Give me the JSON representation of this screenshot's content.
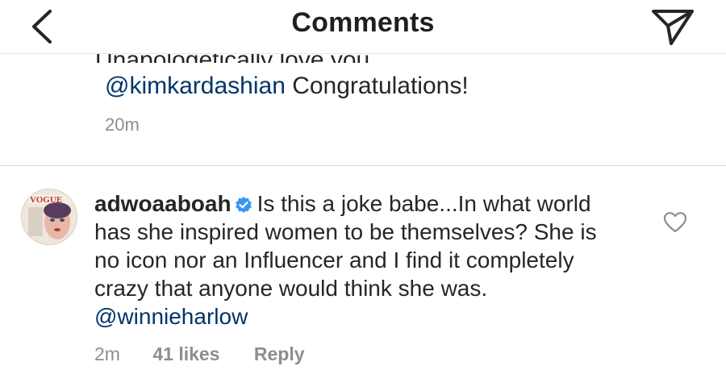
{
  "header": {
    "title": "Comments",
    "back_icon": "chevron-left-icon",
    "share_icon": "paper-plane-icon"
  },
  "previous_comment": {
    "partial_line": "Unapologetically  love you",
    "mention": "@kimkardashian",
    "text": " Congratulations!",
    "time": "20m"
  },
  "comment": {
    "username": "adwoaaboah",
    "verified": true,
    "text": "Is this a joke babe...In what world has she inspired women to be themselves? She is no icon nor an Influencer and I find it completely crazy that anyone would think she was.",
    "mention": "@winnieharlow",
    "time": "2m",
    "likes": "41 likes",
    "reply_label": "Reply"
  },
  "colors": {
    "mention": "#003569",
    "muted": "#8e8e8e",
    "verified": "#3897f0",
    "text": "#262626"
  }
}
